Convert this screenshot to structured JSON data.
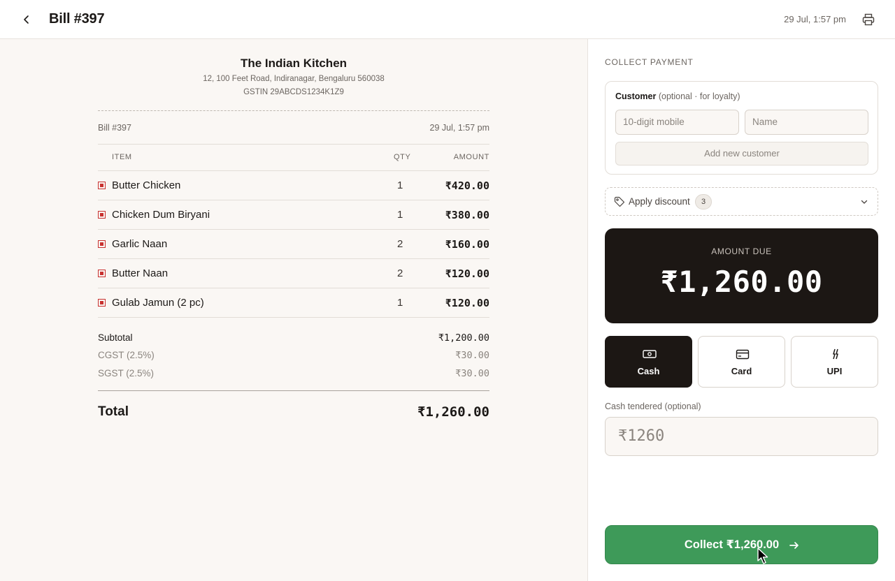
{
  "header": {
    "title": "Bill #397",
    "datetime": "29 Jul, 1:57 pm",
    "icons": {
      "back": "chevron-left-icon",
      "print": "printer-icon"
    }
  },
  "receipt": {
    "restaurant_name": "The Indian Kitchen",
    "address": "12, 100 Feet Road, Indiranagar, Bengaluru 560038",
    "gstin": "GSTIN 29ABCDS1234K1Z9",
    "bill_no": "Bill #397",
    "date": "29 Jul, 1:57 pm",
    "columns": {
      "item": "ITEM",
      "qty": "QTY",
      "amount": "AMOUNT"
    },
    "items": [
      {
        "name": "Butter Chicken",
        "qty": "1",
        "amount": "₹420.00"
      },
      {
        "name": "Chicken Dum Biryani",
        "qty": "1",
        "amount": "₹380.00"
      },
      {
        "name": "Garlic Naan",
        "qty": "2",
        "amount": "₹160.00"
      },
      {
        "name": "Butter Naan",
        "qty": "2",
        "amount": "₹120.00"
      },
      {
        "name": "Gulab Jamun (2 pc)",
        "qty": "1",
        "amount": "₹120.00"
      }
    ],
    "subtotal_label": "Subtotal",
    "subtotal": "₹1,200.00",
    "cgst_label": "CGST (2.5%)",
    "cgst": "₹30.00",
    "sgst_label": "SGST (2.5%)",
    "sgst": "₹30.00",
    "total_label": "Total",
    "total": "₹1,260.00"
  },
  "payment": {
    "section_label": "COLLECT PAYMENT",
    "customer": {
      "title": "Customer",
      "hint": "(optional · for loyalty)",
      "mobile_placeholder": "10-digit mobile",
      "name_placeholder": "Name",
      "add_label": "Add new customer"
    },
    "discount": {
      "label": "Apply discount",
      "count": "3"
    },
    "amount_due_label": "AMOUNT DUE",
    "amount_due": "₹1,260.00",
    "methods": [
      {
        "label": "Cash",
        "icon": "cash-icon",
        "selected": true
      },
      {
        "label": "Card",
        "icon": "credit-card-icon",
        "selected": false
      },
      {
        "label": "UPI",
        "icon": "upi-icon",
        "selected": false
      }
    ],
    "tendered_label": "Cash tendered (optional)",
    "tendered_placeholder": "₹1260",
    "collect_label": "Collect ₹1,260.00"
  },
  "colors": {
    "accent_green": "#3e9a59",
    "dark": "#1c1714",
    "nonveg_red": "#c8312f",
    "panel_bg": "#faf7f4"
  }
}
